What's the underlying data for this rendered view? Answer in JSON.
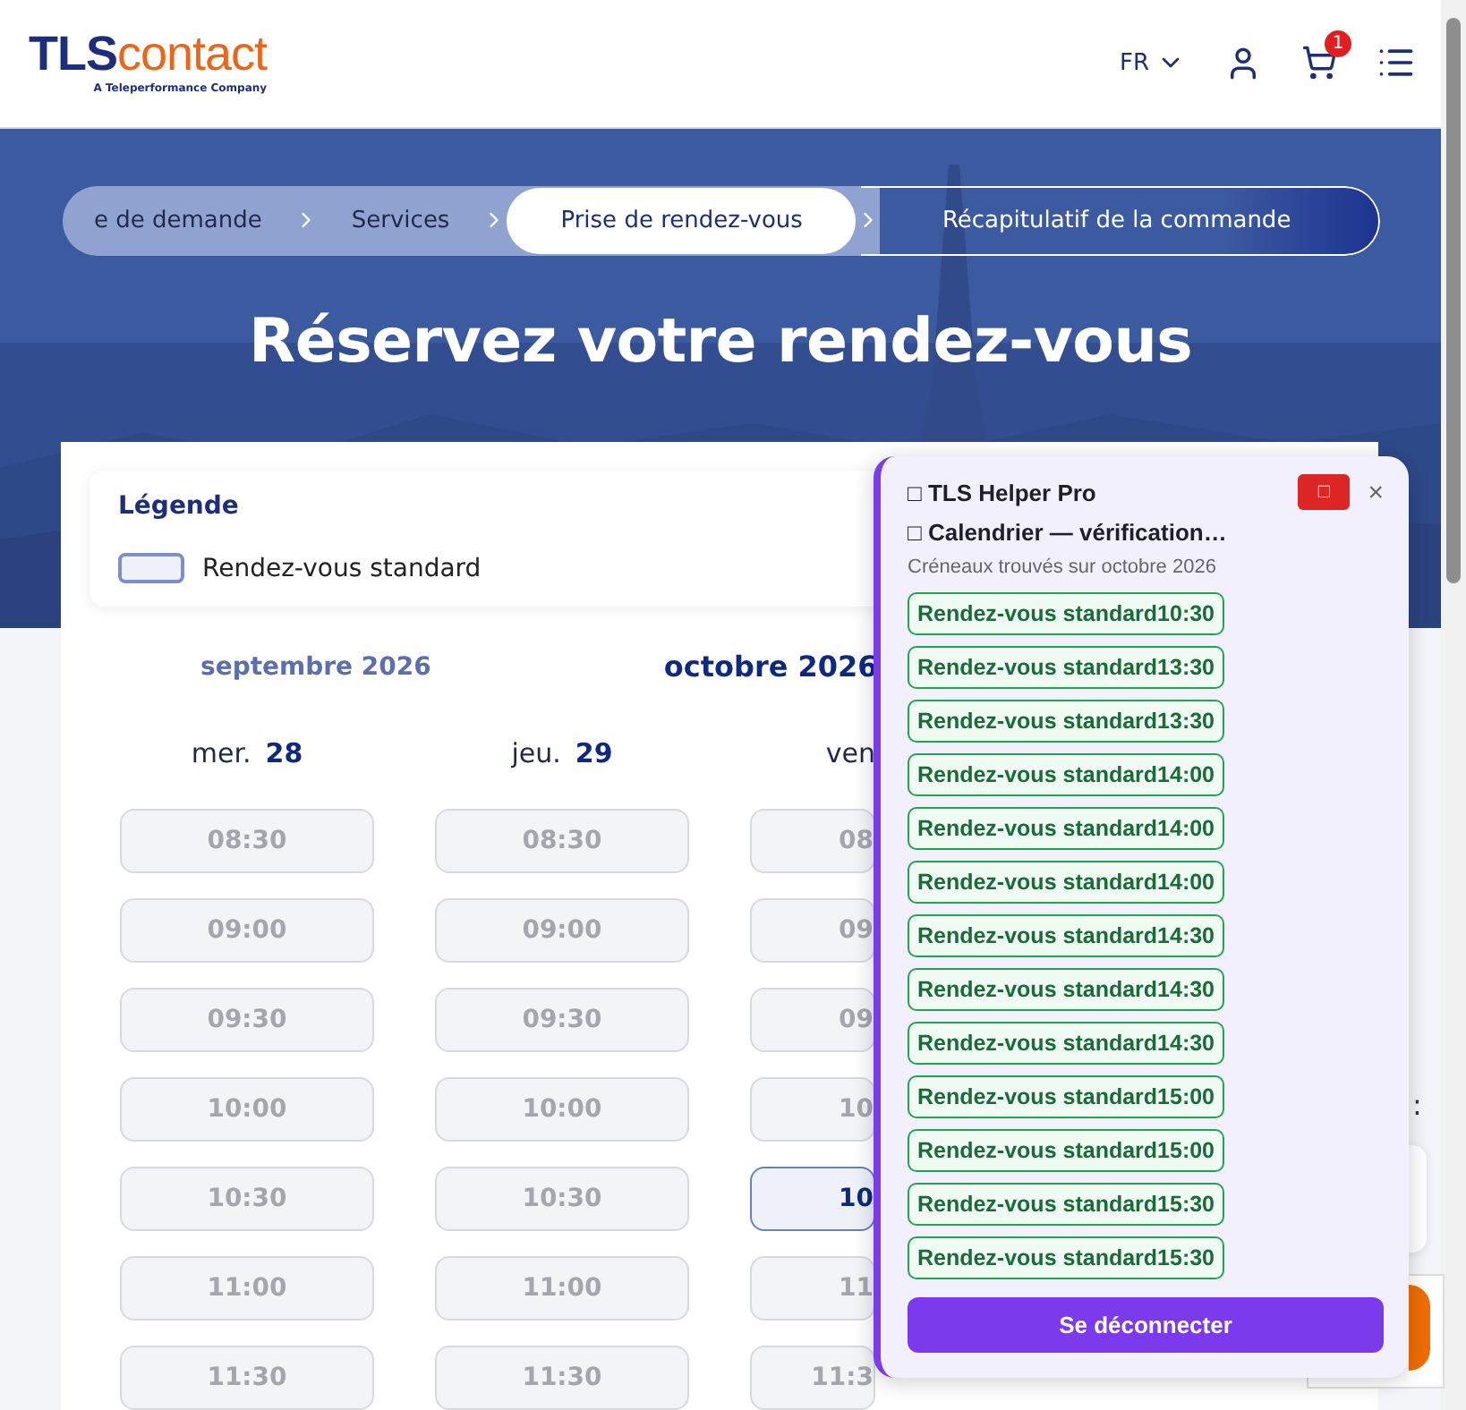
{
  "header": {
    "logo": {
      "main": "TLS",
      "accent": "contact",
      "tagline": "A Teleperformance Company"
    },
    "language": "FR",
    "cart_count": "1"
  },
  "stepper": [
    {
      "label": "e de demande",
      "selected": false,
      "done": true
    },
    {
      "label": "Services",
      "selected": false,
      "done": true
    },
    {
      "label": "Prise de rendez-vous",
      "selected": true,
      "done": false
    },
    {
      "label": "Récapitulatif de la commande",
      "selected": false,
      "done": false
    }
  ],
  "hero_title": "Réservez votre rendez-vous",
  "legend": {
    "title": "Légende",
    "items": [
      "Rendez-vous standard"
    ]
  },
  "months": [
    {
      "label": "septembre 2026",
      "selected": false
    },
    {
      "label": "octobre 2026",
      "selected": true
    }
  ],
  "days": [
    {
      "weekday": "mer.",
      "day": "28",
      "slots": [
        {
          "time": "08:30",
          "available": false
        },
        {
          "time": "09:00",
          "available": false
        },
        {
          "time": "09:30",
          "available": false
        },
        {
          "time": "10:00",
          "available": false
        },
        {
          "time": "10:30",
          "available": false
        },
        {
          "time": "11:00",
          "available": false
        },
        {
          "time": "11:30",
          "available": false
        }
      ]
    },
    {
      "weekday": "jeu.",
      "day": "29",
      "slots": [
        {
          "time": "08:30",
          "available": false
        },
        {
          "time": "09:00",
          "available": false
        },
        {
          "time": "09:30",
          "available": false
        },
        {
          "time": "10:00",
          "available": false
        },
        {
          "time": "10:30",
          "available": false
        },
        {
          "time": "11:00",
          "available": false
        },
        {
          "time": "11:30",
          "available": false
        }
      ]
    },
    {
      "weekday": "ven",
      "slots": [
        {
          "time": "08",
          "available": false
        },
        {
          "time": "09",
          "available": false
        },
        {
          "time": "09",
          "available": false
        },
        {
          "time": "10",
          "available": false
        },
        {
          "time": "10",
          "available": true
        },
        {
          "time": "11",
          "available": false
        },
        {
          "time": "11:3",
          "available": false
        }
      ]
    }
  ],
  "side_fragment": ":",
  "helper": {
    "title": "□ TLS Helper Pro",
    "stop": "□",
    "close": "×",
    "status": "□ Calendrier — vérification…",
    "subtitle": "Créneaux trouvés sur octobre 2026",
    "slots": [
      "Rendez-vous standard10:30",
      "Rendez-vous standard13:30",
      "Rendez-vous standard13:30",
      "Rendez-vous standard14:00",
      "Rendez-vous standard14:00",
      "Rendez-vous standard14:00",
      "Rendez-vous standard14:30",
      "Rendez-vous standard14:30",
      "Rendez-vous standard14:30",
      "Rendez-vous standard15:00",
      "Rendez-vous standard15:00",
      "Rendez-vous standard15:30",
      "Rendez-vous standard15:30"
    ],
    "logout": "Se déconnecter"
  }
}
